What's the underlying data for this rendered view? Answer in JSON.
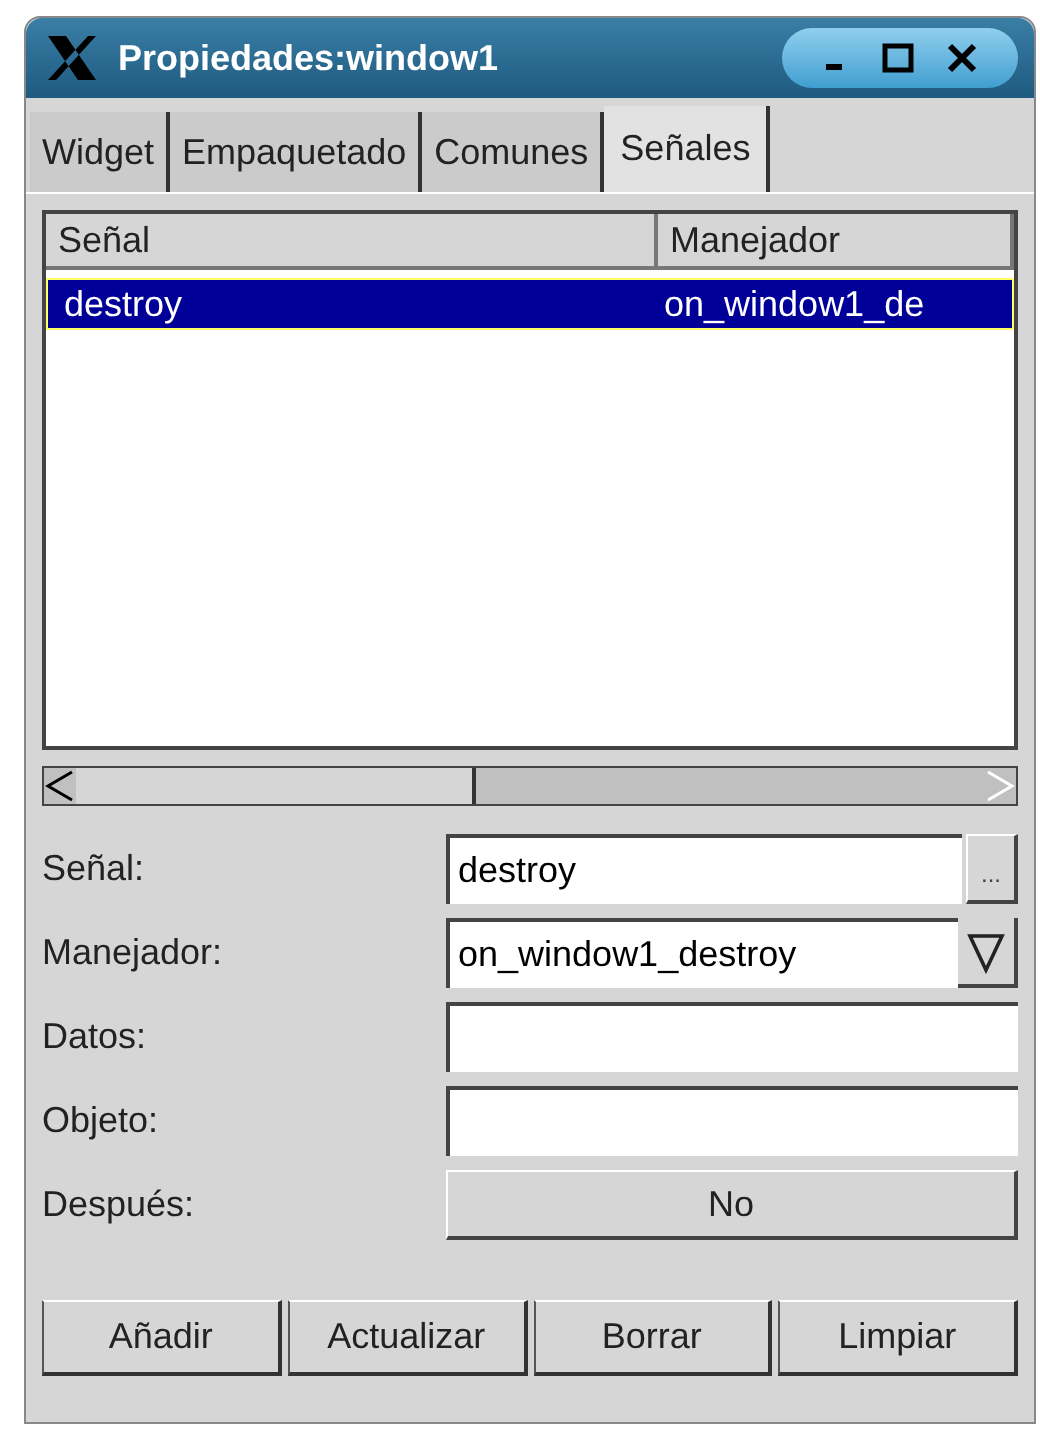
{
  "window": {
    "title": "Propiedades:window1"
  },
  "tabs": [
    {
      "label": "Widget",
      "selected": false
    },
    {
      "label": "Empaquetado",
      "selected": false
    },
    {
      "label": "Comunes",
      "selected": false
    },
    {
      "label": "Señales",
      "selected": true
    }
  ],
  "table": {
    "columns": [
      "Señal",
      "Manejador"
    ],
    "rows": [
      {
        "cells": [
          "destroy",
          "on_window1_de"
        ],
        "selected": true
      }
    ]
  },
  "form": [
    {
      "label": "Señal:",
      "kind": "entry-button",
      "value": "destroy",
      "button": "..."
    },
    {
      "label": "Manejador:",
      "kind": "combo",
      "value": "on_window1_destroy"
    },
    {
      "label": "Datos:",
      "kind": "entry"
    },
    {
      "label": "Objeto:",
      "kind": "entry"
    },
    {
      "label": "Después:",
      "kind": "toggle",
      "value": "No"
    }
  ],
  "buttons": [
    "Añadir",
    "Actualizar",
    "Borrar",
    "Limpiar"
  ]
}
